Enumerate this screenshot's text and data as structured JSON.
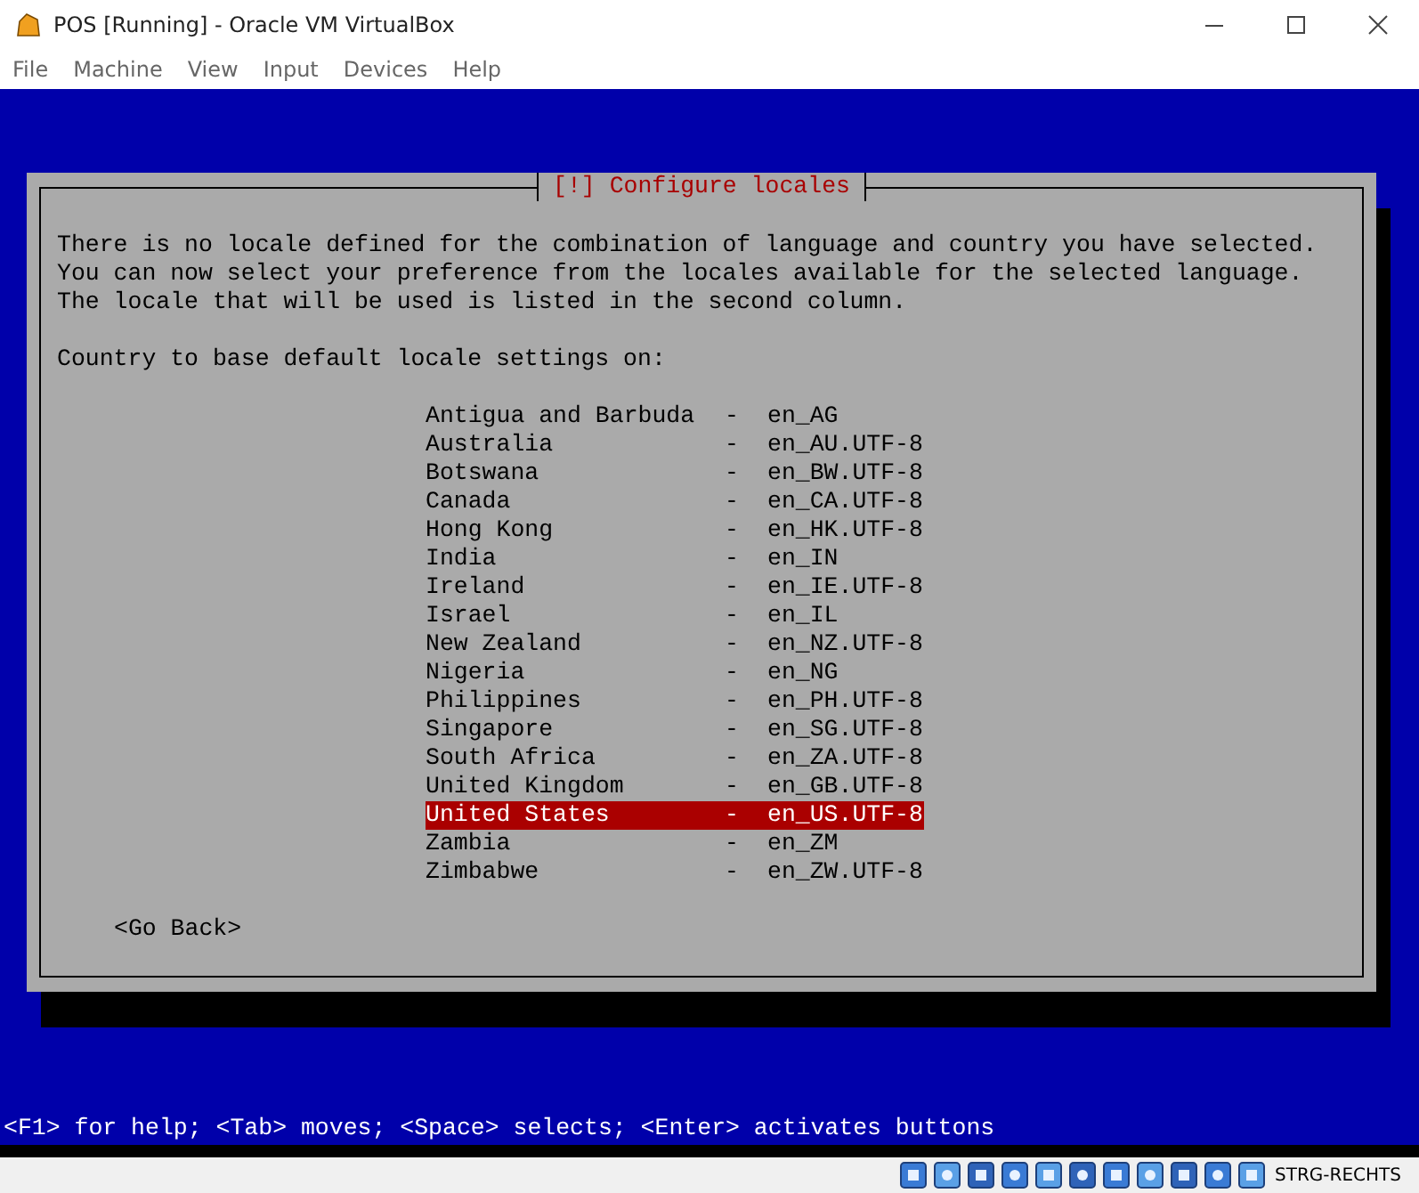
{
  "window": {
    "title": "POS [Running] - Oracle VM VirtualBox"
  },
  "menu": [
    "File",
    "Machine",
    "View",
    "Input",
    "Devices",
    "Help"
  ],
  "dialog": {
    "title": "[!] Configure locales",
    "message": [
      "There is no locale defined for the combination of language and country you have selected.",
      "You can now select your preference from the locales available for the selected language.",
      "The locale that will be used is listed in the second column."
    ],
    "prompt": "Country to base default locale settings on:",
    "options": [
      {
        "country": "Antigua and Barbuda",
        "separator": "-",
        "locale": "en_AG",
        "selected": false
      },
      {
        "country": "Australia",
        "separator": "-",
        "locale": "en_AU.UTF-8",
        "selected": false
      },
      {
        "country": "Botswana",
        "separator": "-",
        "locale": "en_BW.UTF-8",
        "selected": false
      },
      {
        "country": "Canada",
        "separator": "-",
        "locale": "en_CA.UTF-8",
        "selected": false
      },
      {
        "country": "Hong Kong",
        "separator": "-",
        "locale": "en_HK.UTF-8",
        "selected": false
      },
      {
        "country": "India",
        "separator": "-",
        "locale": "en_IN",
        "selected": false
      },
      {
        "country": "Ireland",
        "separator": "-",
        "locale": "en_IE.UTF-8",
        "selected": false
      },
      {
        "country": "Israel",
        "separator": "-",
        "locale": "en_IL",
        "selected": false
      },
      {
        "country": "New Zealand",
        "separator": "-",
        "locale": "en_NZ.UTF-8",
        "selected": false
      },
      {
        "country": "Nigeria",
        "separator": "-",
        "locale": "en_NG",
        "selected": false
      },
      {
        "country": "Philippines",
        "separator": "-",
        "locale": "en_PH.UTF-8",
        "selected": false
      },
      {
        "country": "Singapore",
        "separator": "-",
        "locale": "en_SG.UTF-8",
        "selected": false
      },
      {
        "country": "South Africa",
        "separator": "-",
        "locale": "en_ZA.UTF-8",
        "selected": false
      },
      {
        "country": "United Kingdom",
        "separator": "-",
        "locale": "en_GB.UTF-8",
        "selected": false
      },
      {
        "country": "United States",
        "separator": "-",
        "locale": "en_US.UTF-8",
        "selected": true
      },
      {
        "country": "Zambia",
        "separator": "-",
        "locale": "en_ZM",
        "selected": false
      },
      {
        "country": "Zimbabwe",
        "separator": "-",
        "locale": "en_ZW.UTF-8",
        "selected": false
      }
    ],
    "back_button": "<Go Back>"
  },
  "help_line": "<F1> for help; <Tab> moves; <Space> selects; <Enter> activates buttons",
  "status_bar": {
    "host_key": "STRG-RECHTS"
  }
}
